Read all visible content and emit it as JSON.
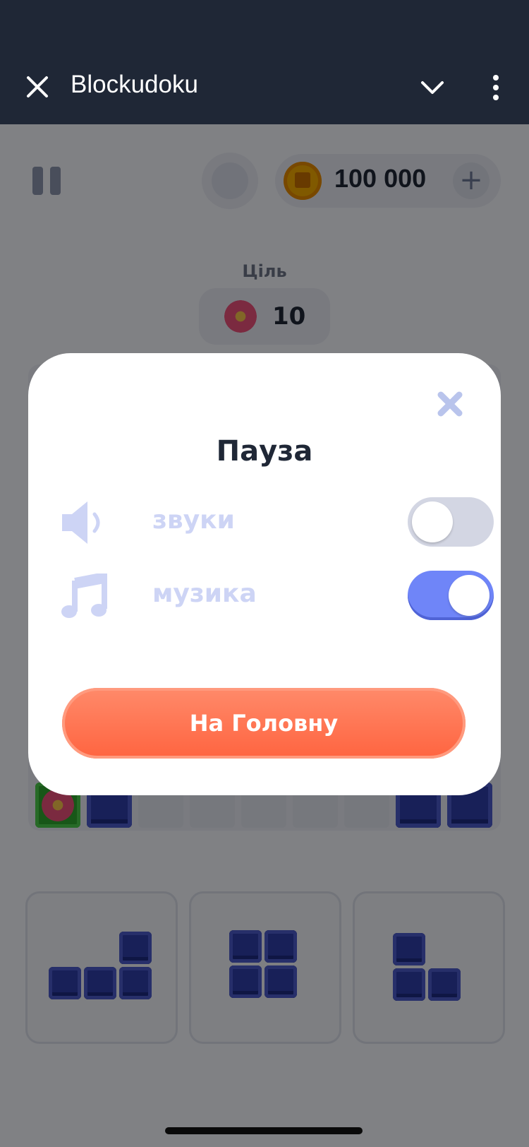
{
  "appbar": {
    "title": "Blockudoku",
    "close_icon": "close-icon",
    "collapse_icon": "chevron-down-icon",
    "menu_icon": "more-vertical-icon"
  },
  "game": {
    "coins": "100 000",
    "goal_label": "Ціль",
    "goal_value": "10",
    "hint_icon": "lightbulb-icon",
    "pause_icon": "pause-icon"
  },
  "modal": {
    "title": "Пауза",
    "close_icon": "close-x-icon",
    "settings": [
      {
        "label": "звуки",
        "icon": "speaker-icon",
        "enabled": false
      },
      {
        "label": "музика",
        "icon": "music-note-icon",
        "enabled": true
      }
    ],
    "home_button": "На Головну"
  },
  "colors": {
    "appbar_bg": "#1f2736",
    "toggle_on": "#6f85f8",
    "toggle_off": "#d3d6e3",
    "home_button": "#ff6f4f",
    "block_blue": "#2f3ea6",
    "setting_label": "#cdd4f5"
  }
}
